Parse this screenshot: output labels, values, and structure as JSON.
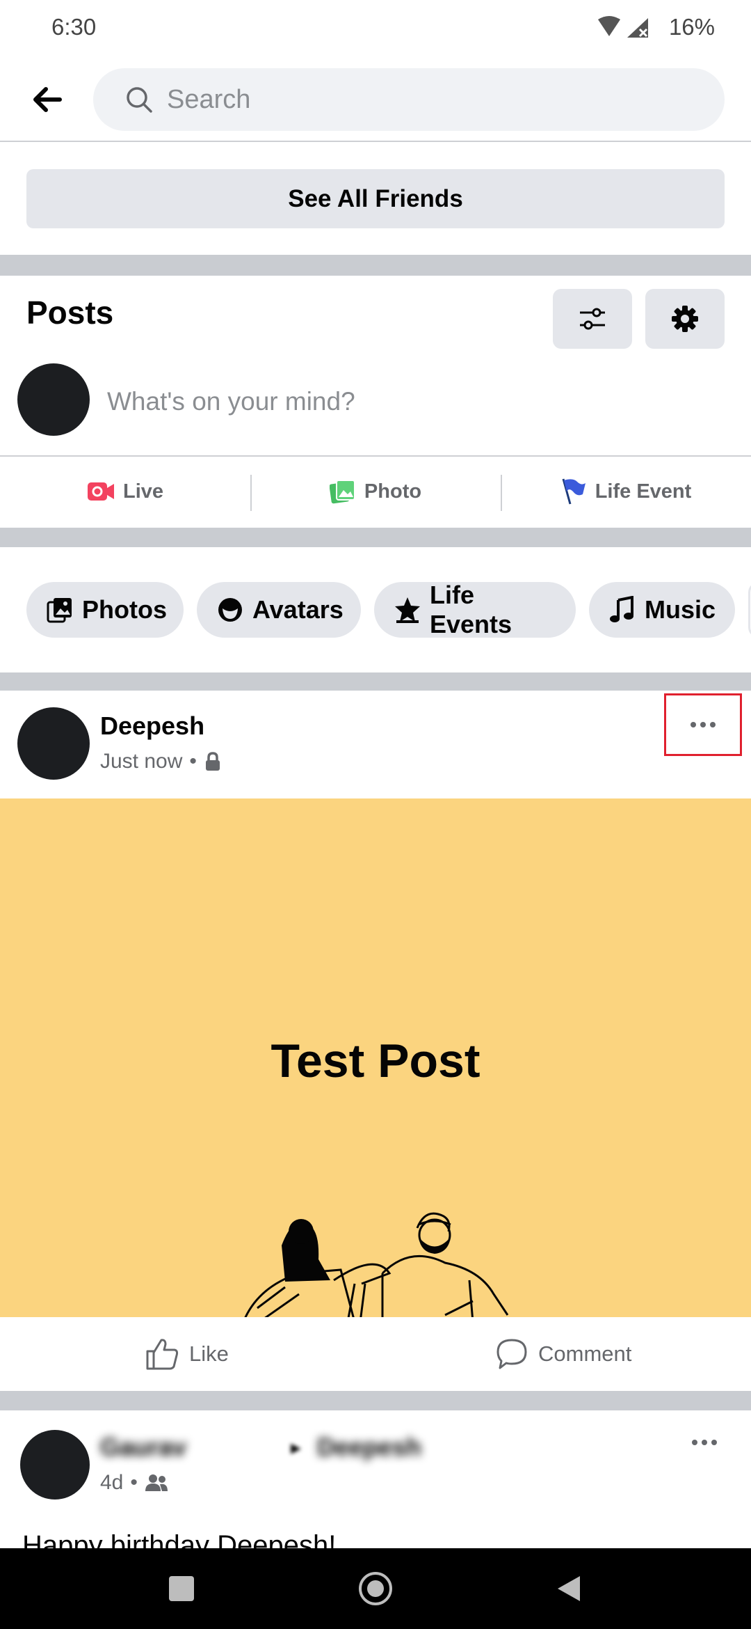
{
  "status": {
    "time": "6:30",
    "battery": "16%",
    "icons": [
      "wifi-icon",
      "signal-icon"
    ]
  },
  "header": {
    "search_placeholder": "Search",
    "back_icon": "back-arrow-icon"
  },
  "friends": {
    "see_all_label": "See All Friends"
  },
  "posts_section": {
    "title": "Posts",
    "filter_icon": "filter-icon",
    "settings_icon": "gear-icon",
    "composer_placeholder": "What's on your mind?",
    "actions": [
      {
        "label": "Live",
        "icon": "live-video-icon",
        "color": "#f3425f"
      },
      {
        "label": "Photo",
        "icon": "photo-icon",
        "color": "#45bd62"
      },
      {
        "label": "Life Event",
        "icon": "flag-icon",
        "color": "#3578e5"
      }
    ]
  },
  "chips": [
    {
      "label": "Photos",
      "icon": "photos-icon"
    },
    {
      "label": "Avatars",
      "icon": "avatar-icon"
    },
    {
      "label": "Life Events",
      "icon": "star-icon"
    },
    {
      "label": "Music",
      "icon": "music-note-icon"
    }
  ],
  "post": {
    "author": "Deepesh",
    "time": "Just now",
    "privacy_icon": "lock-icon",
    "image_text": "Test Post",
    "image_bg": "#fbd47f",
    "like_label": "Like",
    "comment_label": "Comment"
  },
  "post2": {
    "author": "Gaurav",
    "target": "Deepesh",
    "time": "4d",
    "privacy_icon": "friends-icon",
    "body_preview": "Happy birthday Deepesh!"
  }
}
